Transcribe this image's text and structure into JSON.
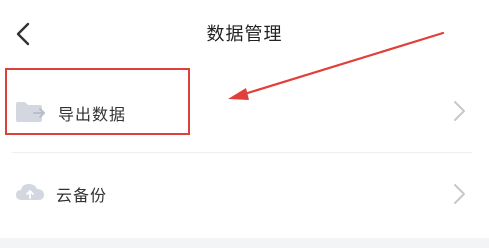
{
  "header": {
    "title": "数据管理",
    "back_icon": "chevron-left-icon"
  },
  "rows": [
    {
      "label": "导出数据",
      "icon": "folder-export-icon",
      "chevron": "chevron-right-icon"
    },
    {
      "label": "云备份",
      "icon": "cloud-icon",
      "chevron": "chevron-right-icon"
    }
  ],
  "colors": {
    "annotation": "#e0403a",
    "icon_gray": "#c9ced6",
    "chevron_gray": "#c8c8c8",
    "text": "#333333"
  }
}
